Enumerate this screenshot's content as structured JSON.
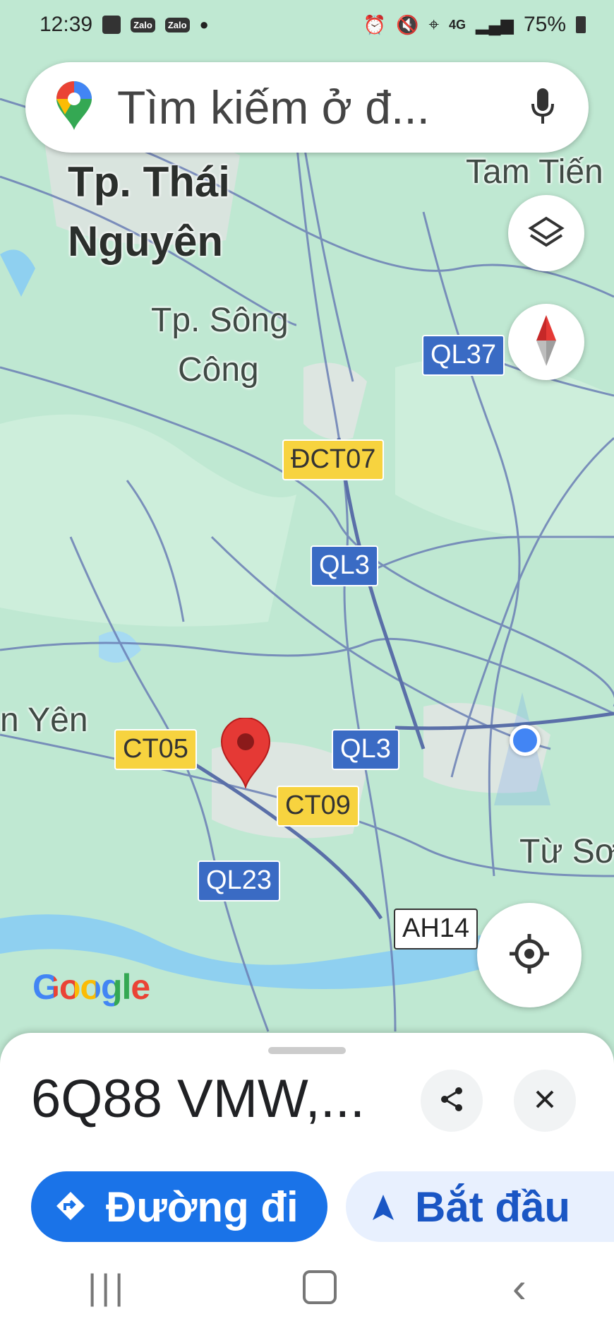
{
  "status_bar": {
    "time": "12:39",
    "app_badges": [
      "Zalo",
      "Zalo"
    ],
    "network": "4G",
    "battery": "75%"
  },
  "search": {
    "placeholder": "Tìm kiếm ở đ..."
  },
  "map_labels": {
    "cities": [
      "Tp. Thái",
      "Nguyên"
    ],
    "towns": [
      {
        "text": "Tp. Sông"
      },
      {
        "text": "Công"
      },
      {
        "text": "Tam Tiến"
      },
      {
        "text": "n Yên"
      },
      {
        "text": "Từ Sơ"
      }
    ],
    "shields": [
      {
        "text": "QL37",
        "kind": "ql"
      },
      {
        "text": "ĐCT07",
        "kind": "ct"
      },
      {
        "text": "QL3",
        "kind": "ql"
      },
      {
        "text": "CT05",
        "kind": "ct"
      },
      {
        "text": "QL3",
        "kind": "ql"
      },
      {
        "text": "CT09",
        "kind": "ct"
      },
      {
        "text": "QL23",
        "kind": "ql"
      },
      {
        "text": "AH14",
        "kind": "ah"
      }
    ]
  },
  "attribution": "Google",
  "place_sheet": {
    "title": "6Q88 VMW,...",
    "directions_label": "Đường đi",
    "start_label": "Bắt đầu"
  },
  "icons": {
    "maps_logo": "google-maps-pin-icon",
    "mic": "microphone-icon",
    "layers": "layers-icon",
    "compass": "compass-icon",
    "locate": "my-location-icon",
    "share": "share-icon",
    "close": "close-icon"
  },
  "colors": {
    "map_green": "#bfe8d2",
    "road": "#6b7fb5",
    "water": "#8fd0f0",
    "pin_red": "#e53935",
    "location_blue": "#4285f4",
    "directions_button": "#1a73e8",
    "start_button_bg": "#e8f0fe"
  }
}
